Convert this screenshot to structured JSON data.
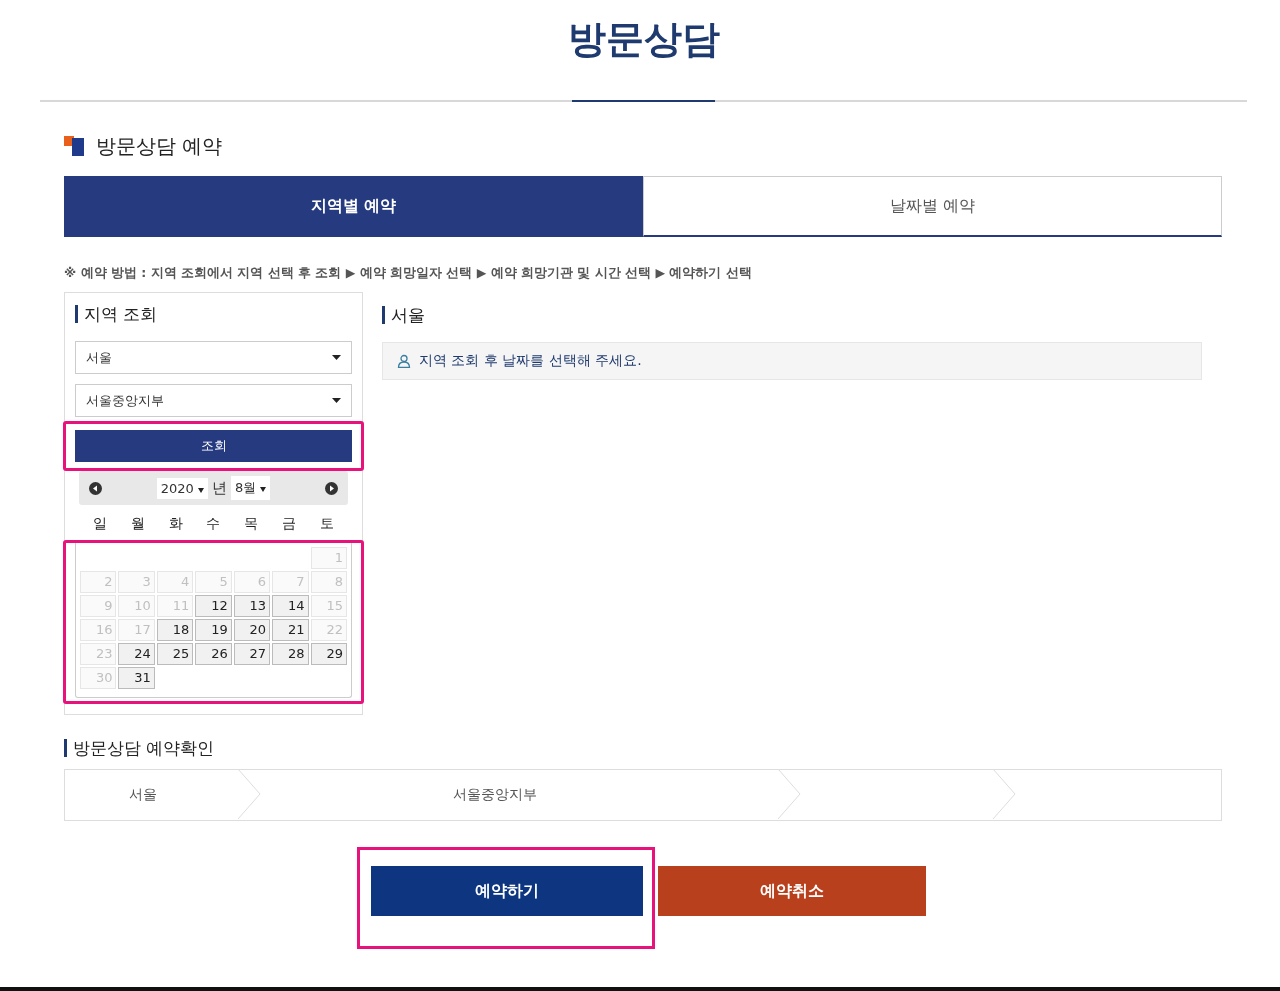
{
  "page_title": "방문상담",
  "section_title": "방문상담 예약",
  "tabs": [
    {
      "label": "지역별 예약",
      "selected": true
    },
    {
      "label": "날짜별 예약",
      "selected": false
    }
  ],
  "guide": {
    "mark": "※",
    "lead": "예약 방법 :",
    "separator": "▶",
    "steps": [
      "지역 조회에서 지역 선택 후 조회",
      "예약 희망일자 선택",
      "예약 희망기관 및 시간 선택",
      "예약하기 선택"
    ]
  },
  "region_panel": {
    "title": "지역 조회",
    "selects": [
      {
        "value": "서울"
      },
      {
        "value": "서울중앙지부"
      }
    ],
    "search_button": {
      "label": "조회",
      "highlighted": true
    }
  },
  "calendar": {
    "year": "2020",
    "year_suffix": "년",
    "month": "8월",
    "weekdays": [
      "일",
      "월",
      "화",
      "수",
      "목",
      "금",
      "토"
    ],
    "highlighted": true,
    "weeks": [
      [
        {
          "day": "1",
          "available": false
        }
      ],
      [
        {
          "day": "2",
          "available": false
        },
        {
          "day": "3",
          "available": false
        },
        {
          "day": "4",
          "available": false
        },
        {
          "day": "5",
          "available": false
        },
        {
          "day": "6",
          "available": false
        },
        {
          "day": "7",
          "available": false
        },
        {
          "day": "8",
          "available": false
        }
      ],
      [
        {
          "day": "9",
          "available": false
        },
        {
          "day": "10",
          "available": false
        },
        {
          "day": "11",
          "available": false
        },
        {
          "day": "12",
          "available": true
        },
        {
          "day": "13",
          "available": true
        },
        {
          "day": "14",
          "available": true
        },
        {
          "day": "15",
          "available": false
        }
      ],
      [
        {
          "day": "16",
          "available": false
        },
        {
          "day": "17",
          "available": false
        },
        {
          "day": "18",
          "available": true
        },
        {
          "day": "19",
          "available": true
        },
        {
          "day": "20",
          "available": true
        },
        {
          "day": "21",
          "available": true
        },
        {
          "day": "22",
          "available": false
        }
      ],
      [
        {
          "day": "23",
          "available": false
        },
        {
          "day": "24",
          "available": true
        },
        {
          "day": "25",
          "available": true
        },
        {
          "day": "26",
          "available": true
        },
        {
          "day": "27",
          "available": true
        },
        {
          "day": "28",
          "available": true
        },
        {
          "day": "29",
          "available": true
        }
      ],
      [
        {
          "day": "30",
          "available": false
        },
        {
          "day": "31",
          "available": true
        }
      ]
    ]
  },
  "result_panel": {
    "title": "서울",
    "notice": "지역 조회 후 날짜를 선택해 주세요."
  },
  "confirm": {
    "title": "방문상담 예약확인",
    "steps": [
      "서울",
      "서울중앙지부"
    ]
  },
  "buttons": [
    {
      "label": "예약하기",
      "kind": "primary",
      "highlighted": true
    },
    {
      "label": "예약취소",
      "kind": "danger",
      "highlighted": false
    }
  ]
}
